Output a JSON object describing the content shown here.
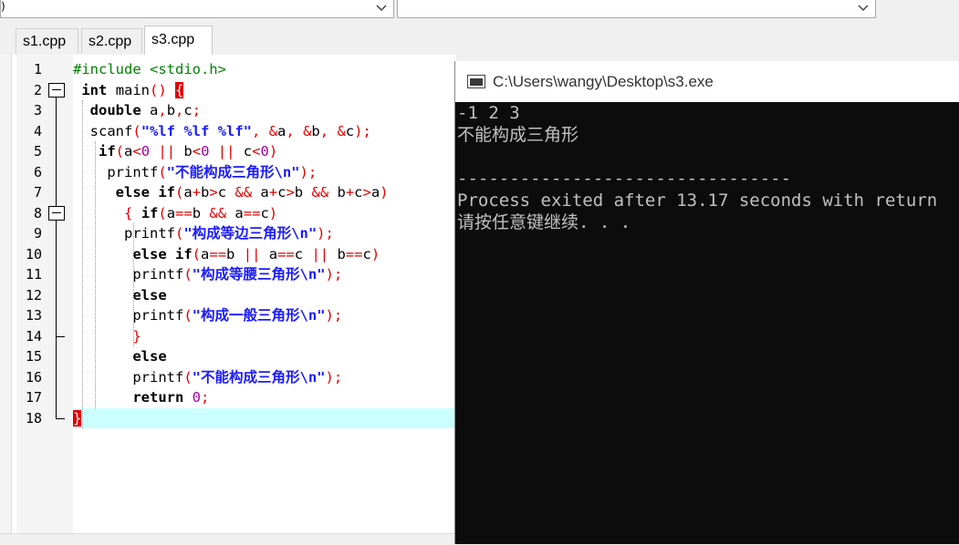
{
  "toolbar": {
    "combo1_text": ")",
    "combo1_arrow": "chevron-down-icon",
    "combo2_arrow": "chevron-down-icon"
  },
  "tabs": [
    {
      "label": "s1.cpp"
    },
    {
      "label": "s2.cpp"
    },
    {
      "label": "s3.cpp",
      "active": true
    }
  ],
  "editor": {
    "line_numbers": [
      "1",
      "2",
      "3",
      "4",
      "5",
      "6",
      "7",
      "8",
      "9",
      "10",
      "11",
      "12",
      "13",
      "14",
      "15",
      "16",
      "17",
      "18"
    ],
    "current_line": 18,
    "lines": [
      "#include <stdio.h>",
      " int main() {",
      "  double a,b,c;",
      "  scanf(\"%lf %lf %lf\", &a, &b, &c);",
      "   if(a<0 || b<0 || c<0)",
      "    printf(\"不能构成三角形\\n\");",
      "     else if(a+b>c && a+c>b && b+c>a)",
      "      { if(a==b && a==c)",
      "      printf(\"构成等边三角形\\n\");",
      "       else if(a==b || a==c || b==c)",
      "       printf(\"构成等腰三角形\\n\");",
      "       else",
      "       printf(\"构成一般三角形\\n\");",
      "       }",
      "       else",
      "       printf(\"不能构成三角形\\n\");",
      "       return 0;",
      "}"
    ]
  },
  "console": {
    "title": "C:\\Users\\wangy\\Desktop\\s3.exe",
    "lines": [
      "-1 2 3",
      "不能构成三角形",
      "",
      "--------------------------------",
      "Process exited after 13.17 seconds with return",
      "请按任意键继续. . ."
    ]
  },
  "colors": {
    "keyword": "#000000",
    "preprocessor": "#008000",
    "string": "#1a1aff",
    "symbol": "#e00000",
    "number": "#a000a0",
    "current_line": "#ccffff",
    "console_bg": "#0c0c0c",
    "console_fg": "#c0c0c0"
  }
}
